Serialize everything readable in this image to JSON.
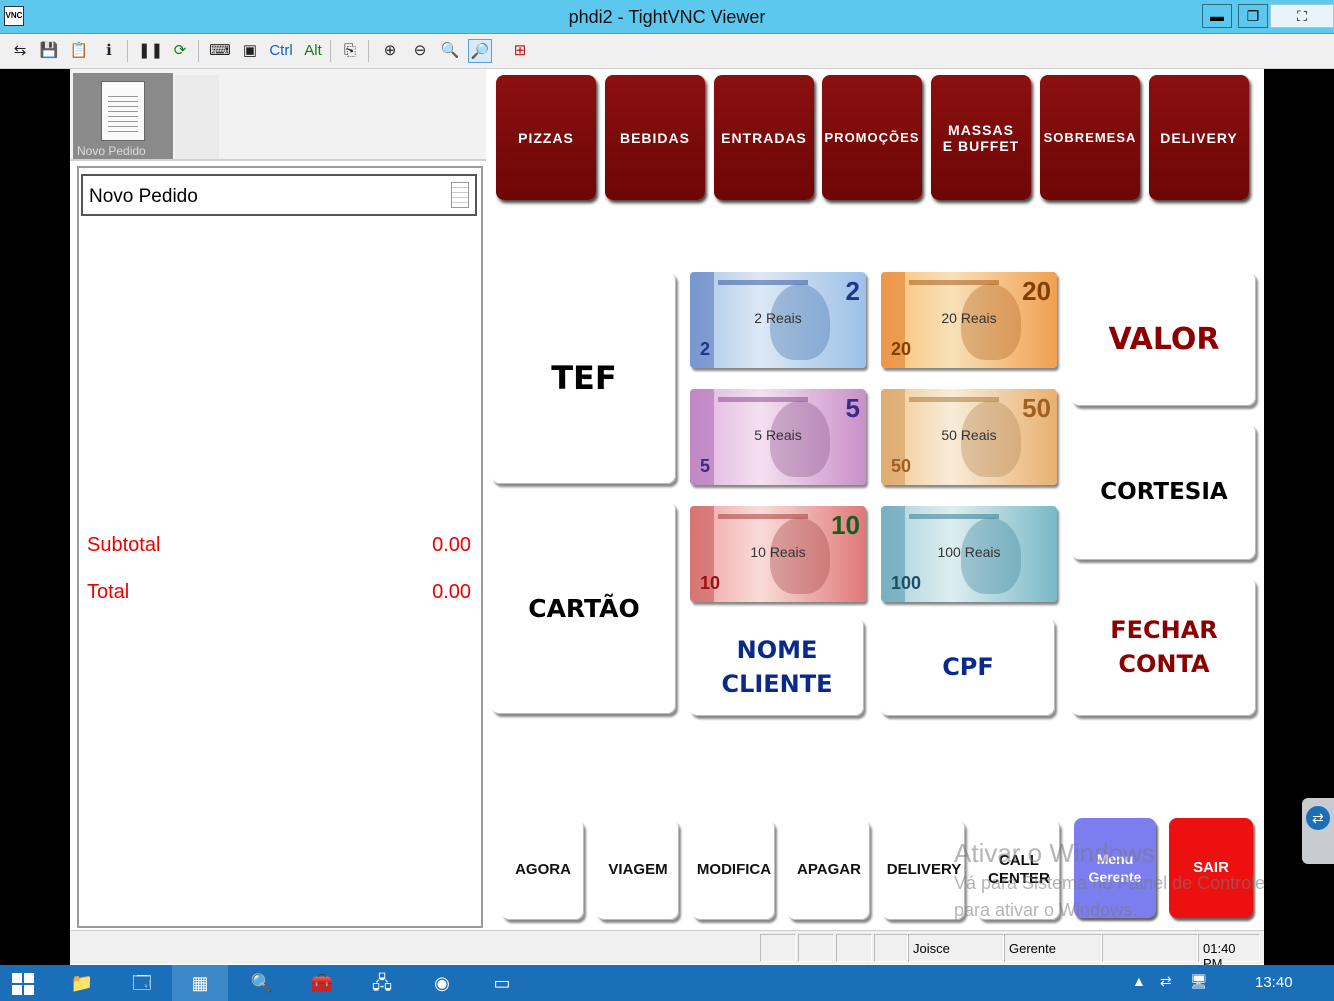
{
  "window": {
    "title": "phdi2 - TightVNC Viewer",
    "app_icon_text": "VNC",
    "minimize_glyph": "▬",
    "restore_glyph": "❐",
    "extra_glyph": "⛶"
  },
  "toolbar": {
    "ctrl_label": "Ctrl",
    "alt_label": "Alt"
  },
  "pos": {
    "thumbnail_caption": "Novo Pedido",
    "order_title": "Novo Pedido",
    "subtotal_label": "Subtotal",
    "subtotal_value": "0.00",
    "total_label": "Total",
    "total_value": "0.00",
    "categories": [
      {
        "label": "PIZZAS"
      },
      {
        "label": "BEBIDAS"
      },
      {
        "label": "ENTRADAS"
      },
      {
        "label": "PROMOÇÕES"
      },
      {
        "label": "MASSAS\nE BUFFET"
      },
      {
        "label": "SOBREMESA"
      },
      {
        "label": "DELIVERY"
      }
    ],
    "payment": {
      "tef": "TEF",
      "cartao": "CARTÃO",
      "nome_cliente": "NOME\nCLIENTE",
      "cpf": "CPF",
      "valor": "VALOR",
      "cortesia": "CORTESIA",
      "fechar_conta": "FECHAR\nCONTA"
    },
    "notes": [
      {
        "label": "2 Reais",
        "value": "2",
        "color": "#7fa6d8"
      },
      {
        "label": "20 Reais",
        "value": "20",
        "color": "#f0a050"
      },
      {
        "label": "5 Reais",
        "value": "5",
        "color": "#c890c8"
      },
      {
        "label": "50 Reais",
        "value": "50",
        "color": "#e8b070"
      },
      {
        "label": "10 Reais",
        "value": "10",
        "color": "#e07878"
      },
      {
        "label": "100 Reais",
        "value": "100",
        "color": "#7ab8c8"
      }
    ],
    "bottom_buttons": [
      {
        "label": "AGORA"
      },
      {
        "label": "VIAGEM"
      },
      {
        "label": "MODIFICA"
      },
      {
        "label": "APAGAR"
      },
      {
        "label": "DELIVERY"
      },
      {
        "label": "CALL\nCENTER"
      }
    ],
    "menu_gerente": "Menu\nGerente",
    "sair": "SAIR",
    "watermark": {
      "line1": "Ativar o Windows",
      "line2": "Vá para Sistema no Painel de Controle",
      "line3": "para ativar o Windows."
    },
    "status": {
      "user": "Joisce",
      "role": "Gerente",
      "time": "01:40 PM"
    },
    "colors": {
      "category_bg": "#7a0a0a",
      "valor_text": "#8b0000",
      "blue_text": "#0a2a8a",
      "menu_gerente_bg": "#7c7ef0",
      "sair_bg": "#ee1010",
      "total_text": "#ee0000"
    }
  },
  "taskbar": {
    "clock": "13:40"
  }
}
